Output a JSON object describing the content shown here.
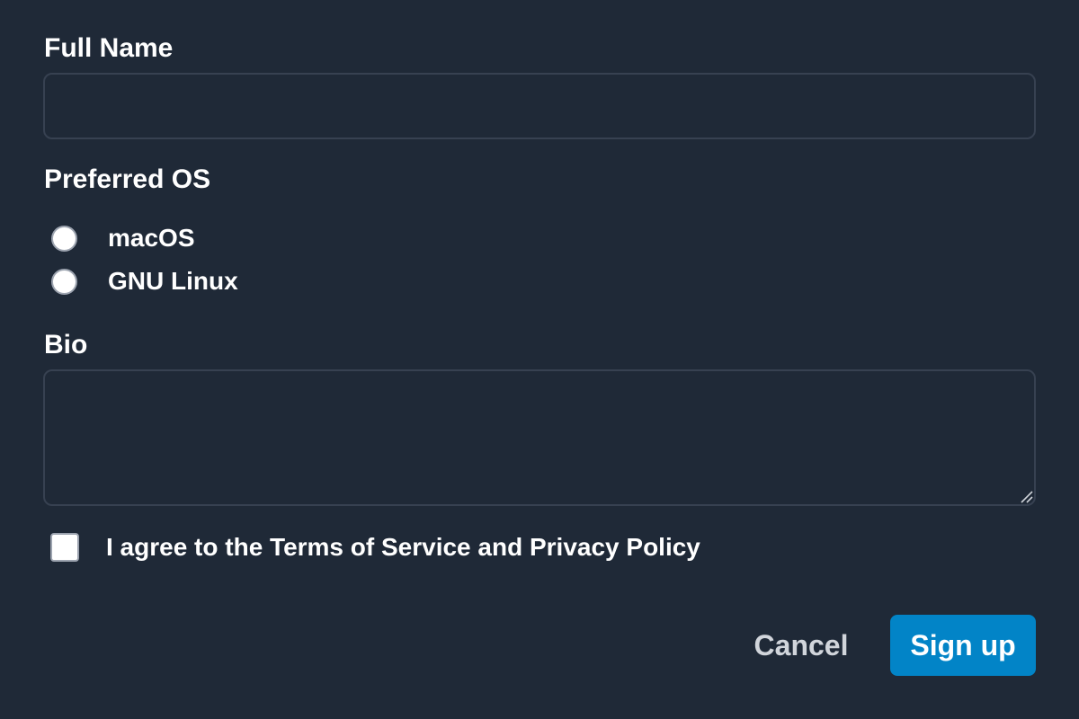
{
  "form": {
    "full_name": {
      "label": "Full Name",
      "value": "",
      "placeholder": ""
    },
    "preferred_os": {
      "label": "Preferred OS",
      "options": [
        {
          "label": "macOS",
          "checked": false
        },
        {
          "label": "GNU Linux",
          "checked": false
        }
      ]
    },
    "bio": {
      "label": "Bio",
      "value": "",
      "placeholder": ""
    },
    "terms": {
      "label": "I agree to the Terms of Service and Privacy Policy",
      "checked": false
    }
  },
  "actions": {
    "cancel_label": "Cancel",
    "signup_label": "Sign up"
  },
  "icons": {
    "textarea_resize": "resize-grip-icon"
  },
  "colors": {
    "background": "#1f2937",
    "border": "#374151",
    "primary": "#0284c7",
    "text": "#ffffff",
    "muted_text": "#d1d5db"
  }
}
